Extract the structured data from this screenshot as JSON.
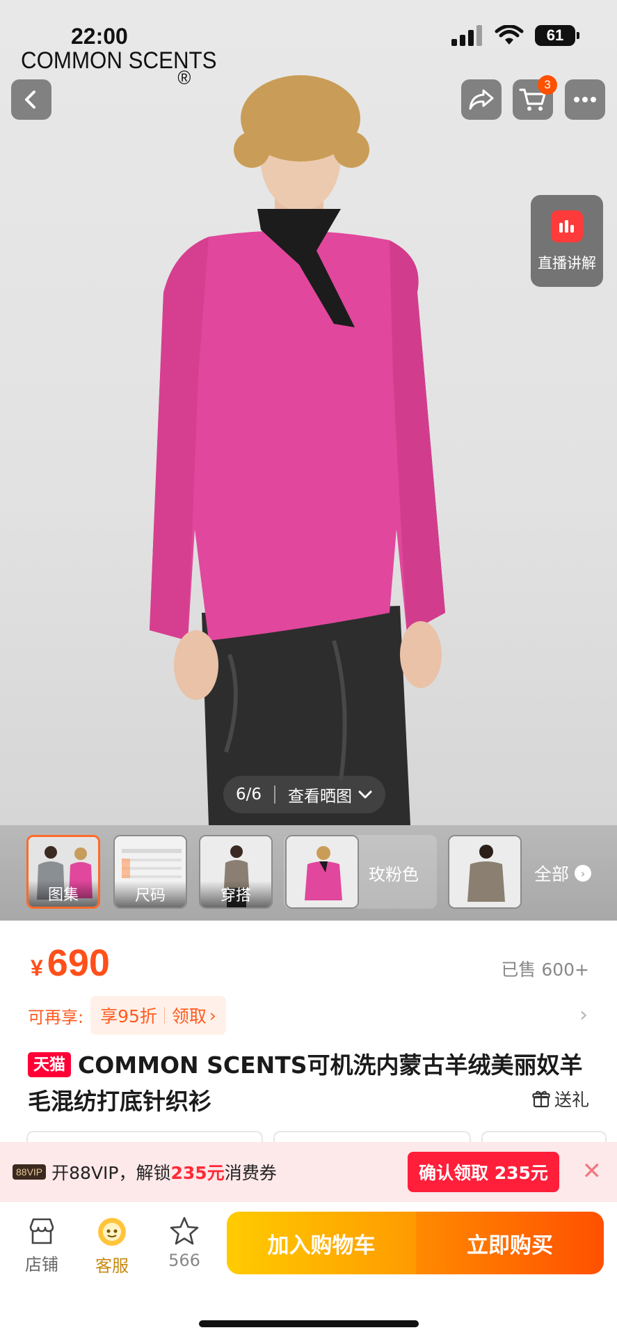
{
  "status_bar": {
    "time": "22:00",
    "battery": "61"
  },
  "brand": {
    "name": "COMMON SCENTS",
    "mark": "®"
  },
  "header": {
    "cart_count": "3"
  },
  "live": {
    "label": "直播讲解"
  },
  "gallery": {
    "counter": "6/6",
    "view_label": "查看晒图"
  },
  "thumbnails": {
    "items": [
      {
        "label": "图集"
      },
      {
        "label": "尺码"
      },
      {
        "label": "穿搭"
      }
    ],
    "color_label": "玫粉色",
    "all_label": "全部"
  },
  "price": {
    "currency": "¥",
    "amount": "690",
    "sold": "已售 600+"
  },
  "coupon": {
    "lead": "可再享:",
    "discount": "享95折",
    "claim": "领取"
  },
  "product": {
    "badge": "天猫",
    "title": "COMMON SCENTS可机洗内蒙古羊绒美丽奴羊毛混纺打底针织衫",
    "gift": "送礼"
  },
  "vip": {
    "badge": "88VIP",
    "text_before": "开88VIP，解锁",
    "amount": "235元",
    "text_after": "消费券",
    "button": "确认领取 235元"
  },
  "bottom": {
    "store": "店铺",
    "service": "客服",
    "favorites": "566",
    "add_cart": "加入购物车",
    "buy_now": "立即购买"
  },
  "colors": {
    "accent": "#ff5000",
    "price": "#ff4f1a",
    "tmall": "#ff0036",
    "vip_button": "#ff1f3a"
  }
}
